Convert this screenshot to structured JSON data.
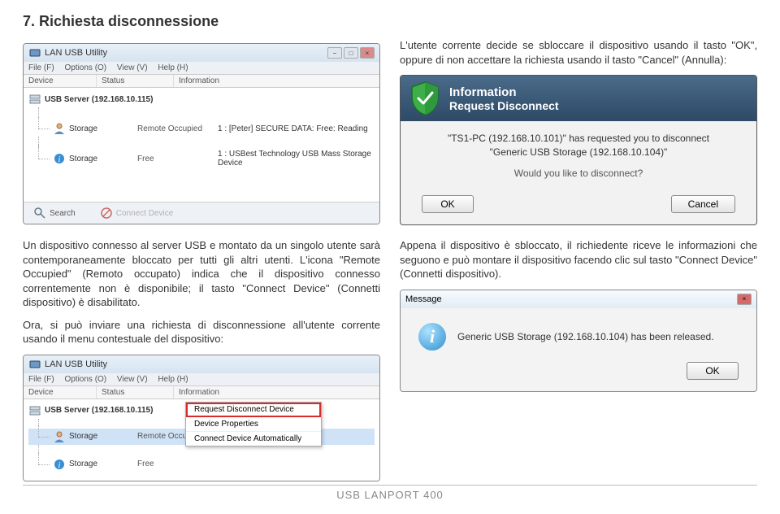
{
  "heading": "7. Richiesta disconnessione",
  "intro": "L'utente corrente decide se sbloccare il dispositivo usando il tasto \"OK\", oppure di non accettare la richiesta usando il tasto \"Cancel\" (Annulla):",
  "app": {
    "title": "LAN USB Utility",
    "menu": {
      "file": "File (F)",
      "options": "Options (O)",
      "view": "View (V)",
      "help": "Help (H)"
    },
    "cols": {
      "device": "Device",
      "status": "Status",
      "info": "Information"
    },
    "row_server": "USB Server (192.168.10.115)",
    "row_storage": {
      "name": "Storage",
      "status_occupied": "Remote Occupied",
      "status_free": "Free",
      "info_occupied": "1 : [Peter] SECURE DATA: Free: Reading",
      "info_free": "1 : USBest Technology USB Mass Storage Device"
    },
    "toolbar": {
      "search": "Search",
      "connect": "Connect Device"
    }
  },
  "dialog": {
    "title": "Information",
    "subtitle": "Request Disconnect",
    "line1": "\"TS1-PC (192.168.10.101)\" has requested you to disconnect",
    "line2": "\"Generic  USB Storage (192.168.10.104)\"",
    "question": "Would you like to disconnect?",
    "ok": "OK",
    "cancel": "Cancel"
  },
  "para2": "Un dispositivo connesso al server USB e montato da un singolo utente sarà contemporaneamente bloccato per tutti gli altri utenti. L'icona \"Remote Occupied\" (Remoto occupato) indica che il dispositivo connesso correntemente non è disponibile; il tasto \"Connect Device\" (Connetti dispositivo) è disabilitato.",
  "para3": "Ora, si può inviare una richiesta di disconnessione all'utente corrente usando il menu contestuale del dispositivo:",
  "para4": "Appena il dispositivo è sbloccato, il richiedente riceve le informazioni che seguono e può montare il dispositivo facendo clic sul tasto \"Connect Device\" (Connetti dispositivo).",
  "msg": {
    "title": "Message",
    "body": "Generic USB Storage (192.168.10.104) has been released.",
    "ok": "OK"
  },
  "context": {
    "request": "Request Disconnect Device",
    "properties": "Device Properties",
    "auto": "Connect Device Automatically"
  },
  "footer": "USB LANPORT 400"
}
